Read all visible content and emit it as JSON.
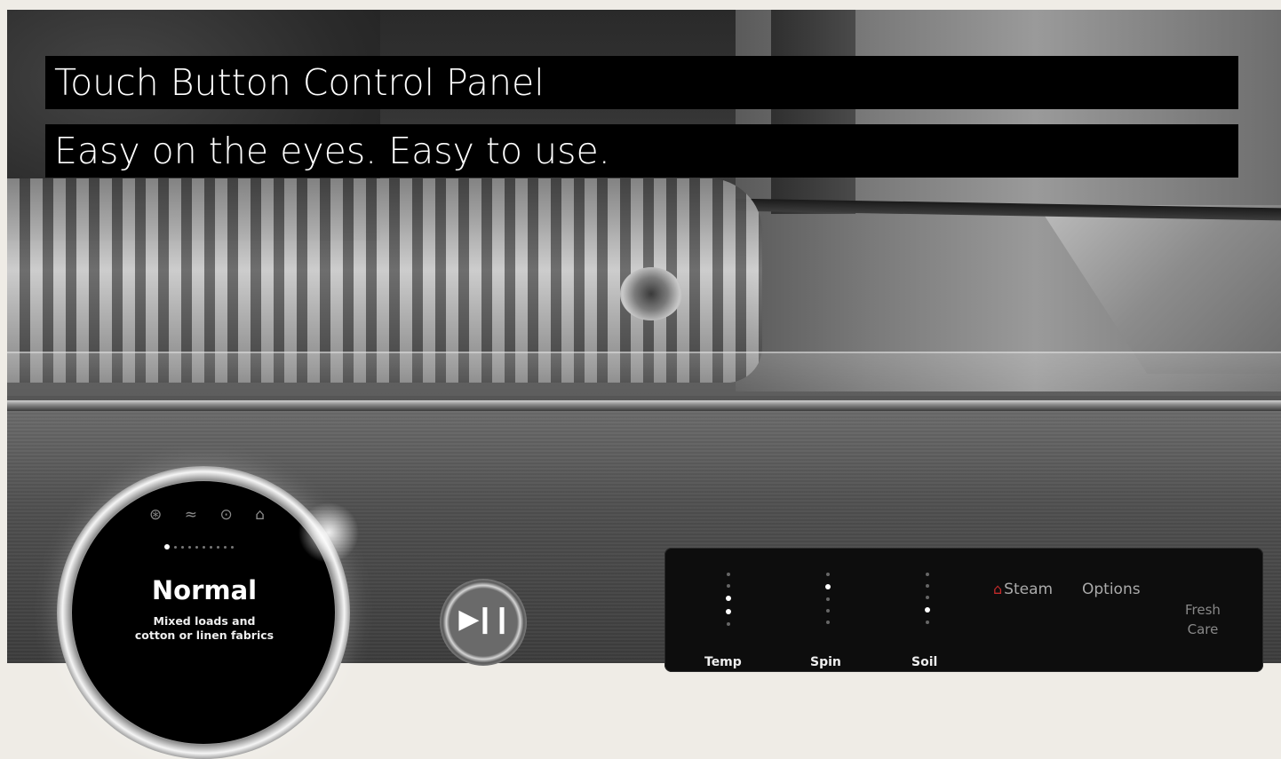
{
  "caption": {
    "title": "Touch Button Control Panel",
    "subtitle": "Easy on the eyes. Easy to use."
  },
  "dial": {
    "cycle_name": "Normal",
    "cycle_description_line1": "Mixed loads and",
    "cycle_description_line2": "cotton or linen fabrics",
    "status_icons": [
      "drum-icon",
      "wifi-icon",
      "remote-start-icon",
      "lock-icon"
    ],
    "page_dots_total": 10,
    "page_dots_active_index": 0
  },
  "start_pause": {
    "icon": "play-pause-icon"
  },
  "control_strip": {
    "steam_label": "Steam",
    "options_label": "Options",
    "fresh_care_line1": "Fresh",
    "fresh_care_line2": "Care",
    "bottom_labels": [
      "Temp",
      "Spin",
      "Soil"
    ],
    "level_columns": [
      {
        "dots": 5,
        "active": [
          2,
          3
        ]
      },
      {
        "dots": 5,
        "active": [
          1
        ]
      },
      {
        "dots": 5,
        "active": [
          3
        ]
      }
    ]
  },
  "colors": {
    "caption_bg": "#000000",
    "caption_text": "#ffffff",
    "steam_accent": "#c22a2a"
  }
}
